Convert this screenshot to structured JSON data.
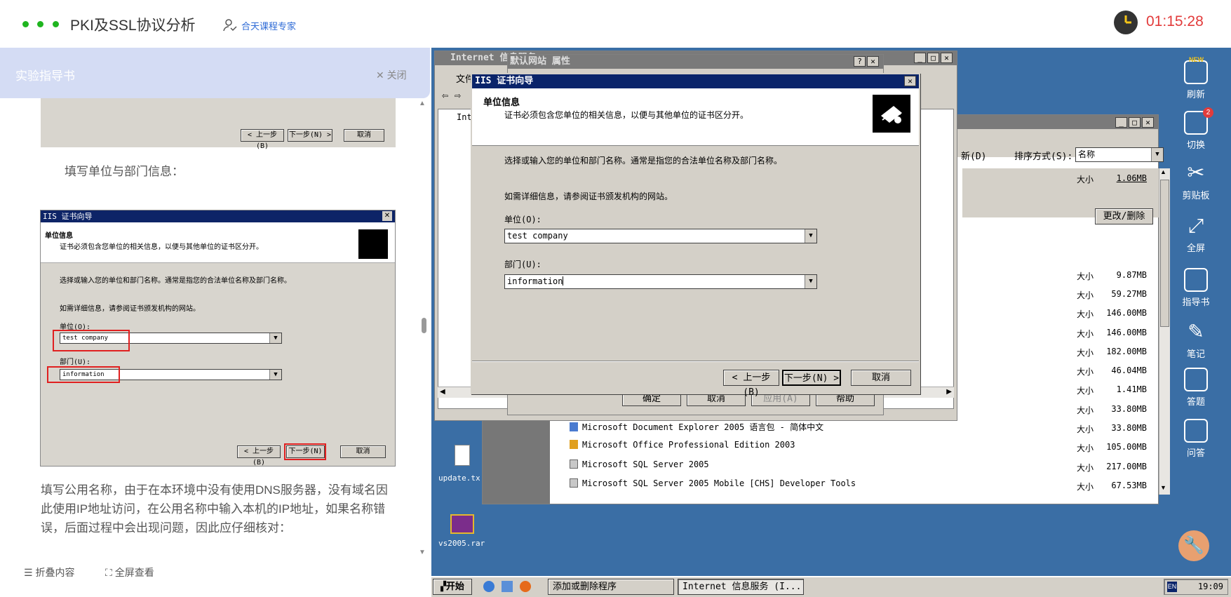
{
  "header": {
    "title": "PKI及SSL协议分析",
    "expert": "合天课程专家",
    "timer": "01:15:28"
  },
  "guide": {
    "title": "实验指导书",
    "close": "关闭",
    "top_buttons": [
      "< 上一步(B)",
      "下一步(N) >",
      "取消"
    ],
    "para1": "填写单位与部门信息：",
    "mini": {
      "title": "IIS 证书向导",
      "head": "单位信息",
      "sub": "证书必须包含您单位的相关信息，以便与其他单位的证书区分开。",
      "line1": "选择或输入您的单位和部门名称。通常是指您的合法单位名称及部门名称。",
      "line2": "如需详细信息，请参阅证书颁发机构的网站。",
      "org_label": "单位(O):",
      "org_value": "test company",
      "dept_label": "部门(U):",
      "dept_value": "information",
      "buttons": [
        "< 上一步(B)",
        "下一步(N)",
        "取消"
      ]
    },
    "para2": "填写公用名称，由于在本环境中没有使用DNS服务器，没有域名因此使用IP地址访问，在公用名称中输入本机的IP地址，如果名称错误，后面过程中会出现问题，因此应仔细核对：",
    "fold": "折叠内容",
    "fullscreen": "全屏查看"
  },
  "iis_window": {
    "title": "Internet 信息服务",
    "menu": "文件",
    "tree_item": "Int"
  },
  "props_dialog": {
    "title": "默认网站 属性",
    "buttons": [
      "确定",
      "取消",
      "应用(A)",
      "帮助"
    ]
  },
  "wizard": {
    "title": "IIS 证书向导",
    "head": "单位信息",
    "sub": "证书必须包含您单位的相关信息，以便与其他单位的证书区分开。",
    "line1": "选择或输入您的单位和部门名称。通常是指您的合法单位名称及部门名称。",
    "line2": "如需详细信息，请参阅证书颁发机构的网站。",
    "org_label": "单位(O):",
    "org_value": "test company",
    "dept_label": "部门(U):",
    "dept_value": "information",
    "back": "< 上一步(B)",
    "next": "下一步(N) >",
    "cancel": "取消"
  },
  "programs": {
    "new_label": "新(D)",
    "sort_label": "排序方式(S):",
    "sort_value": "名称",
    "change_remove": "更改/删除",
    "size_label": "大小",
    "sizes": [
      "1.06MB",
      "9.87MB",
      "59.27MB",
      "146.00MB",
      "146.00MB",
      "182.00MB",
      "46.04MB",
      "1.41MB",
      "33.80MB",
      "33.80MB",
      "105.00MB",
      "217.00MB",
      "67.53MB"
    ],
    "items": [
      "Microsoft Document Explorer 2005 语言包 - 简体中文",
      "Microsoft Office Professional Edition 2003",
      "Microsoft SQL Server 2005",
      "Microsoft SQL Server 2005 Mobile [CHS] Developer Tools"
    ]
  },
  "desktop": {
    "icons": [
      "update.tx",
      "vs2005.rar"
    ]
  },
  "sidebar": {
    "new_badge": "NEW",
    "switch_badge": "2",
    "tools": [
      "刷新",
      "切换",
      "剪贴板",
      "全屏",
      "指导书",
      "笔记",
      "答题",
      "问答"
    ]
  },
  "taskbar": {
    "start": "开始",
    "task1": "添加或删除程序",
    "task2": "Internet 信息服务 (I...",
    "lang": "EN",
    "clock": "19:09"
  }
}
